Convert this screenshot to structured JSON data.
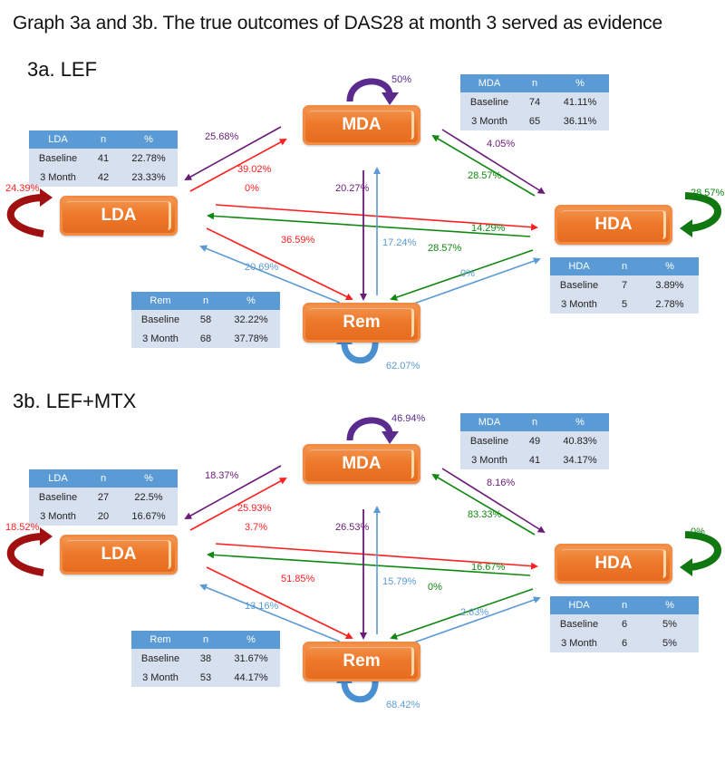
{
  "title": "Graph 3a and 3b. The true outcomes of DAS28 at month 3 served as evidence",
  "colors": {
    "node_fill": "#ee7a2c",
    "table_header": "#5b9bd5",
    "table_body": "#d6e0ef",
    "from_LDA": "#ff2020",
    "from_MDA": "#6a1b7a",
    "from_HDA": "#118811",
    "from_Rem": "#5b9bd5",
    "self_LDA": "#a01010",
    "self_MDA": "#5b2a8e",
    "self_HDA": "#117711",
    "self_Rem": "#4a8fd0"
  },
  "table_headers": [
    "n",
    "%"
  ],
  "panels": [
    {
      "title": "3a. LEF",
      "nodes": {
        "MDA": "MDA",
        "LDA": "LDA",
        "HDA": "HDA",
        "Rem": "Rem"
      },
      "tables": {
        "LDA": {
          "name": "LDA",
          "rows": [
            {
              "label": "Baseline",
              "n": "41",
              "pct": "22.78%"
            },
            {
              "label": "3 Month",
              "n": "42",
              "pct": "23.33%"
            }
          ]
        },
        "MDA": {
          "name": "MDA",
          "rows": [
            {
              "label": "Baseline",
              "n": "74",
              "pct": "41.11%"
            },
            {
              "label": "3 Month",
              "n": "65",
              "pct": "36.11%"
            }
          ]
        },
        "HDA": {
          "name": "HDA",
          "rows": [
            {
              "label": "Baseline",
              "n": "7",
              "pct": "3.89%"
            },
            {
              "label": "3 Month",
              "n": "5",
              "pct": "2.78%"
            }
          ]
        },
        "Rem": {
          "name": "Rem",
          "rows": [
            {
              "label": "Baseline",
              "n": "58",
              "pct": "32.22%"
            },
            {
              "label": "3 Month",
              "n": "68",
              "pct": "37.78%"
            }
          ]
        }
      },
      "self": {
        "LDA": "24.39%",
        "MDA": "50%",
        "HDA": "28.57%",
        "Rem": "62.07%"
      },
      "transitions": {
        "MDA_to_LDA": "25.68%",
        "LDA_to_MDA": "39.02%",
        "LDA_to_HDA": "0%",
        "HDA_to_LDA": "14.29%",
        "LDA_to_Rem": "36.59%",
        "Rem_to_LDA": "20.69%",
        "MDA_to_Rem": "20.27%",
        "Rem_to_MDA": "17.24%",
        "MDA_to_HDA": "4.05%",
        "HDA_to_MDA": "28.57%",
        "HDA_to_Rem": "28.57%",
        "Rem_to_HDA": "0%"
      }
    },
    {
      "title": "3b. LEF+MTX",
      "nodes": {
        "MDA": "MDA",
        "LDA": "LDA",
        "HDA": "HDA",
        "Rem": "Rem"
      },
      "tables": {
        "LDA": {
          "name": "LDA",
          "rows": [
            {
              "label": "Baseline",
              "n": "27",
              "pct": "22.5%"
            },
            {
              "label": "3 Month",
              "n": "20",
              "pct": "16.67%"
            }
          ]
        },
        "MDA": {
          "name": "MDA",
          "rows": [
            {
              "label": "Baseline",
              "n": "49",
              "pct": "40.83%"
            },
            {
              "label": "3 Month",
              "n": "41",
              "pct": "34.17%"
            }
          ]
        },
        "HDA": {
          "name": "HDA",
          "rows": [
            {
              "label": "Baseline",
              "n": "6",
              "pct": "5%"
            },
            {
              "label": "3 Month",
              "n": "6",
              "pct": "5%"
            }
          ]
        },
        "Rem": {
          "name": "Rem",
          "rows": [
            {
              "label": "Baseline",
              "n": "38",
              "pct": "31.67%"
            },
            {
              "label": "3 Month",
              "n": "53",
              "pct": "44.17%"
            }
          ]
        }
      },
      "self": {
        "LDA": "18.52%",
        "MDA": "46.94%",
        "HDA": "0%",
        "Rem": "68.42%"
      },
      "transitions": {
        "MDA_to_LDA": "18.37%",
        "LDA_to_MDA": "25.93%",
        "LDA_to_HDA": "3.7%",
        "HDA_to_LDA": "16.67%",
        "LDA_to_Rem": "51.85%",
        "Rem_to_LDA": "13.16%",
        "MDA_to_Rem": "26.53%",
        "Rem_to_MDA": "15.79%",
        "MDA_to_HDA": "8.16%",
        "HDA_to_MDA": "83.33%",
        "HDA_to_Rem": "0%",
        "Rem_to_HDA": "2.63%"
      }
    }
  ]
}
